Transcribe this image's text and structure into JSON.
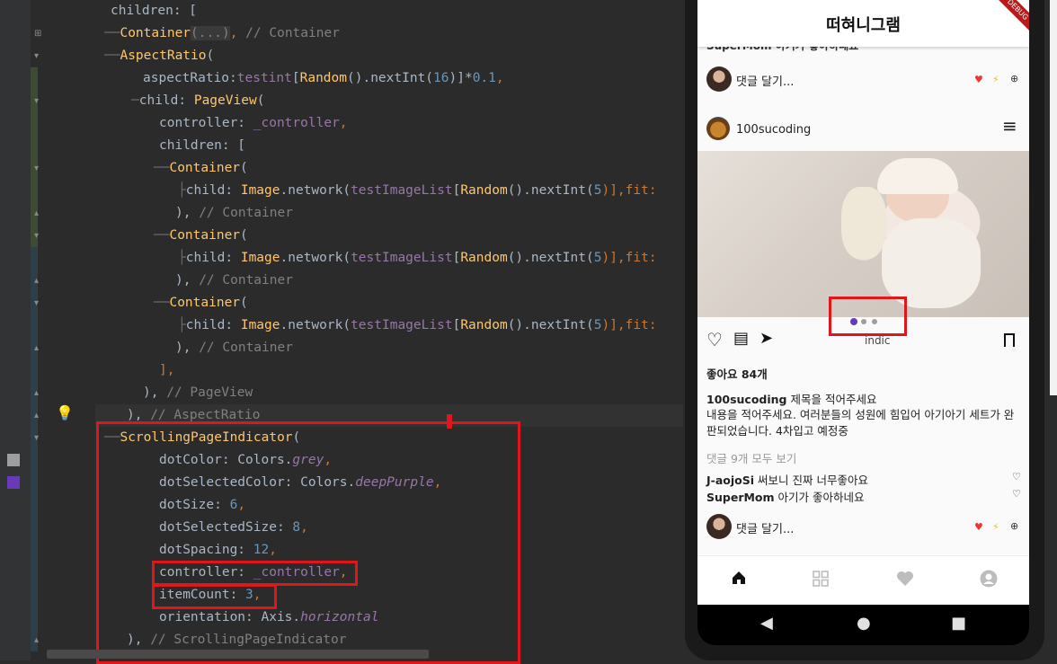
{
  "code": {
    "lines": [
      {
        "indent": "children: ["
      },
      {
        "a": "Container",
        "b": "(...)",
        "c": ", ",
        "d": "// Container"
      },
      {
        "a": "AspectRatio",
        "b": "("
      },
      {
        "a": "aspectRatio:",
        "b": "testint",
        "c": "[",
        "d": "Random",
        "e": "().nextInt(",
        "f": "16",
        "g": ")]*",
        "h": "0.1",
        "i": ","
      },
      {
        "a": "child: ",
        "b": "PageView",
        "c": "("
      },
      {
        "a": "controller: ",
        "b": "_controller",
        "c": ","
      },
      {
        "a": "children: ["
      },
      {
        "a": "Container",
        "b": "("
      },
      {
        "a": "child: ",
        "b": "Image",
        "c": ".network(",
        "d": "testImageList",
        "e": "[",
        "f": "Random",
        "g": "().nextInt(",
        "h": "5",
        "i": ")],fit:"
      },
      {
        "a": "), ",
        "b": "// Container"
      },
      {
        "a": "Container",
        "b": "("
      },
      {
        "a": "child: ",
        "b": "Image",
        "c": ".network(",
        "d": "testImageList",
        "e": "[",
        "f": "Random",
        "g": "().nextInt(",
        "h": "5",
        "i": ")],fit:"
      },
      {
        "a": "), ",
        "b": "// Container"
      },
      {
        "a": "Container",
        "b": "("
      },
      {
        "a": "child: ",
        "b": "Image",
        "c": ".network(",
        "d": "testImageList",
        "e": "[",
        "f": "Random",
        "g": "().nextInt(",
        "h": "5",
        "i": ")],fit:"
      },
      {
        "a": "), ",
        "b": "// Container"
      },
      {
        "a": "],"
      },
      {
        "a": "), ",
        "b": "// PageView"
      },
      {
        "a": "), ",
        "b": "// AspectRatio"
      },
      {
        "a": "ScrollingPageIndicator",
        "b": "("
      },
      {
        "a": "dotColor: Colors.",
        "b": "grey",
        "c": ","
      },
      {
        "a": "dotSelectedColor: Colors.",
        "b": "deepPurple",
        "c": ","
      },
      {
        "a": "dotSize: ",
        "b": "6",
        "c": ","
      },
      {
        "a": "dotSelectedSize: ",
        "b": "8",
        "c": ","
      },
      {
        "a": "dotSpacing: ",
        "b": "12",
        "c": ","
      },
      {
        "a": "controller: ",
        "b": "_controller",
        "c": ","
      },
      {
        "a": "itemCount: ",
        "b": "3",
        "c": ","
      },
      {
        "a": "orientation: Axis.",
        "b": "horizontal"
      },
      {
        "a": "), ",
        "b": "// ScrollingPageIndicator"
      }
    ]
  },
  "app": {
    "title": "떠혀니그램",
    "debug_banner": "DEBUG",
    "cut_top_comment": "SuperMom 아기가 좋아하네요",
    "comment_placeholder": "댓글 달기...",
    "post_user": "100sucoding",
    "indicator_label": "indic",
    "likes": "좋아요 84개",
    "caption_user": "100sucoding",
    "caption_title": " 제목을 적어주세요",
    "caption_body": "내용을 적어주세요. 여러분들의 성원에 힘입어 아기아기 세트가 완판되었습니다. 4차입고 예정중",
    "view_all_comments": "댓글 9개 모두 보기",
    "comments": [
      {
        "user": "J-aojoSi",
        "text": " 써보니 진짜 너무좋아요"
      },
      {
        "user": "SuperMom",
        "text": " 아기가 좋아하네요"
      }
    ],
    "icons": {
      "heart": "♥",
      "bolt": "⚡",
      "plus": "⊕",
      "menu": "≡",
      "like": "♡",
      "comment": "▤",
      "send": "➤",
      "bookmark": "🔖",
      "small_heart": "♡"
    },
    "nav": [
      "home-icon",
      "grid-icon",
      "heart-icon",
      "profile-icon"
    ],
    "android": {
      "back": "◀",
      "home": "●",
      "recent": "■"
    }
  },
  "colors": {
    "accent_red_box": "#e0161c",
    "dot_selected": "#673ab7",
    "dot": "#9e9e9e"
  }
}
